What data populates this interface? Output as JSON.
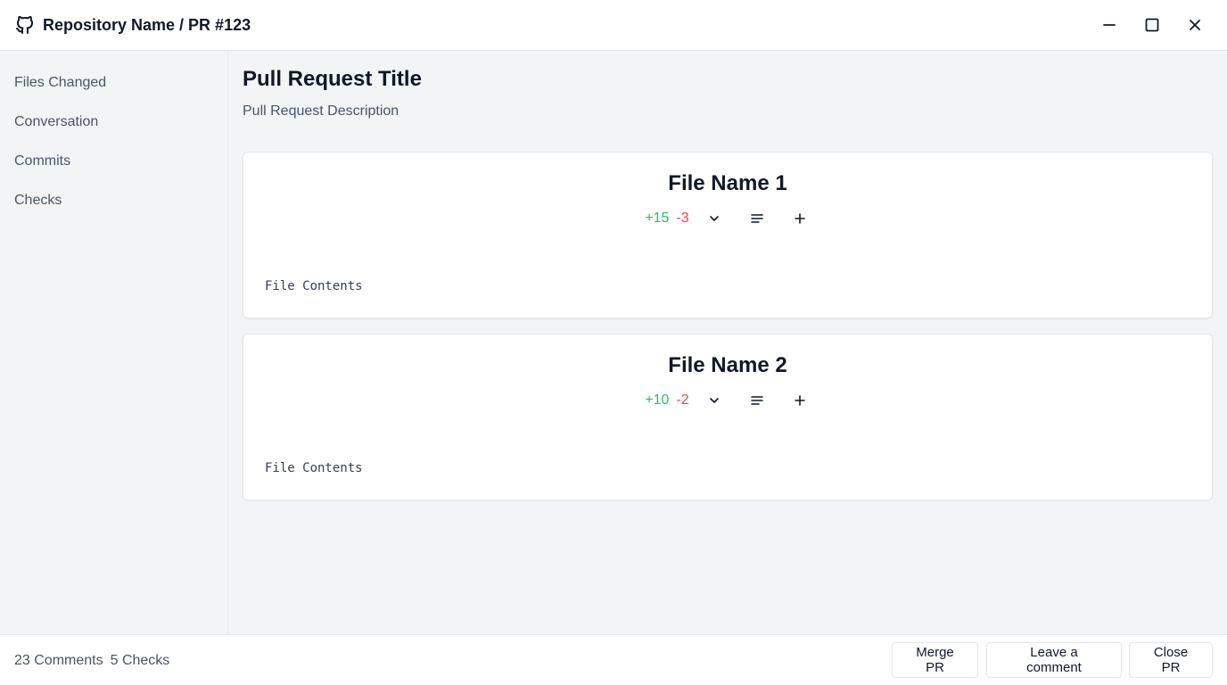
{
  "window": {
    "title": "Repository Name / PR #123",
    "logo_icon": "github-icon",
    "controls": [
      "minimize-icon",
      "maximize-icon",
      "close-icon"
    ]
  },
  "sidebar": {
    "items": [
      {
        "label": "Files Changed"
      },
      {
        "label": "Conversation"
      },
      {
        "label": "Commits"
      },
      {
        "label": "Checks"
      }
    ]
  },
  "pr": {
    "title": "Pull Request Title",
    "description": "Pull Request Description"
  },
  "files": [
    {
      "name": "File Name 1",
      "additions": "+15",
      "deletions": "-3",
      "contents": "File Contents"
    },
    {
      "name": "File Name 2",
      "additions": "+10",
      "deletions": "-2",
      "contents": "File Contents"
    }
  ],
  "file_actions": [
    "chevron-down-icon",
    "align-left-icon",
    "plus-icon"
  ],
  "footer": {
    "comments": "23 Comments",
    "checks": "5 Checks",
    "buttons": {
      "merge": "Merge PR",
      "comment": "Leave a comment",
      "close": "Close PR"
    }
  },
  "colors": {
    "additions": "#22c55e",
    "deletions": "#ef4444",
    "background": "#f3f4f6"
  }
}
